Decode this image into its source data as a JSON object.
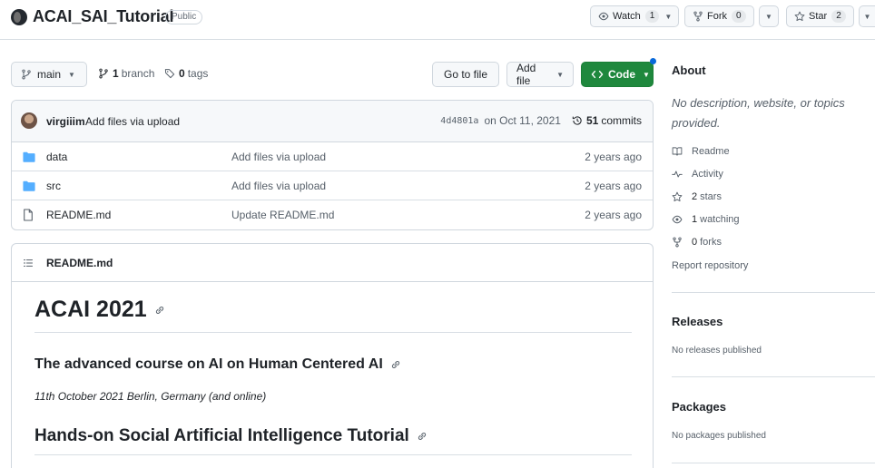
{
  "repo": {
    "name": "ACAI_SAI_Tutorial",
    "visibility": "Public"
  },
  "header_actions": {
    "watch": {
      "label": "Watch",
      "count": "1"
    },
    "fork": {
      "label": "Fork",
      "count": "0"
    },
    "star": {
      "label": "Star",
      "count": "2"
    }
  },
  "toolbar": {
    "branch": "main",
    "branches_count": "1",
    "branches_label": "branch",
    "tags_count": "0",
    "tags_label": "tags",
    "goto_file": "Go to file",
    "add_file": "Add file",
    "code": "Code"
  },
  "commit": {
    "user": "virgiiim",
    "message": "Add files via upload",
    "sha": "4d4801a",
    "date": "on Oct 11, 2021",
    "commits_count": "51",
    "commits_label": "commits"
  },
  "files": [
    {
      "type": "folder",
      "name": "data",
      "message": "Add files via upload",
      "age": "2 years ago"
    },
    {
      "type": "folder",
      "name": "src",
      "message": "Add files via upload",
      "age": "2 years ago"
    },
    {
      "type": "file",
      "name": "README.md",
      "message": "Update README.md",
      "age": "2 years ago"
    }
  ],
  "readme": {
    "title": "README.md",
    "h1": "ACAI 2021",
    "h2_course": "The advanced course on AI on Human Centered AI",
    "date_place": "11th October 2021 Berlin, Germany (and online)",
    "h2_tutorial": "Hands-on Social Artificial Intelligence Tutorial"
  },
  "about": {
    "heading": "About",
    "description": "No description, website, or topics provided.",
    "readme": "Readme",
    "activity": "Activity",
    "stars_count": "2",
    "stars_label": "stars",
    "watching_count": "1",
    "watching_label": "watching",
    "forks_count": "0",
    "forks_label": "forks",
    "report": "Report repository"
  },
  "releases": {
    "heading": "Releases",
    "empty": "No releases published"
  },
  "packages": {
    "heading": "Packages",
    "empty": "No packages published"
  },
  "colors": {
    "code_button": "#1f883d",
    "folder_icon": "#54aeff",
    "link_blue": "#0969da"
  }
}
